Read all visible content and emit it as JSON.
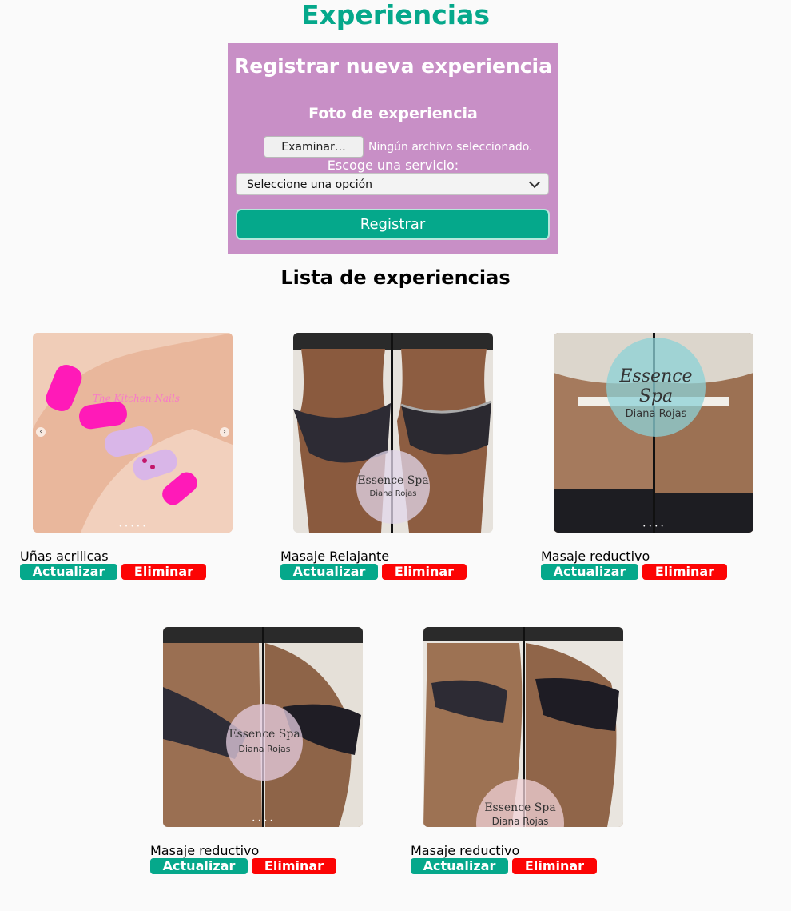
{
  "page": {
    "title": "Experiencias"
  },
  "form": {
    "title": "Registrar nueva experiencia",
    "photo_label": "Foto de experiencia",
    "file_button": "Examinar…",
    "file_status": "Ningún archivo seleccionado.",
    "service_label": "Escoge una servicio:",
    "service_selected": "Seleccione una opción",
    "submit_label": "Registrar"
  },
  "list": {
    "title": "Lista de experiencias"
  },
  "buttons": {
    "update": "Actualizar",
    "delete": "Eliminar"
  },
  "watermark": {
    "line1": "Essence Spa",
    "line2": "Diana Rojas",
    "nails_text": "The Kitchen Nails"
  },
  "experiences": [
    {
      "name": "Uñas acrilicas"
    },
    {
      "name": "Masaje Relajante"
    },
    {
      "name": "Masaje reductivo"
    },
    {
      "name": "Masaje reductivo"
    },
    {
      "name": "Masaje reductivo"
    }
  ],
  "colors": {
    "accent": "#05a88b",
    "form_bg": "#c88fc6",
    "danger": "#fc0404",
    "page_bg": "#fafafa"
  }
}
